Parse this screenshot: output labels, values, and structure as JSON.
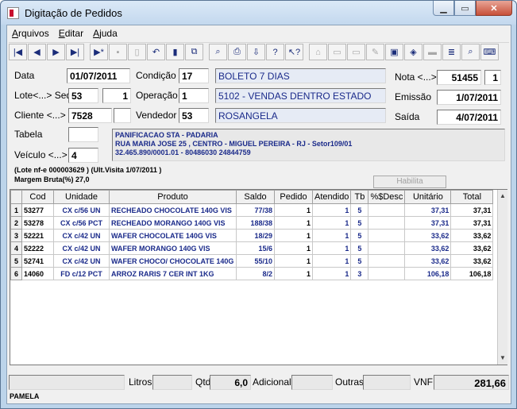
{
  "window": {
    "title": "Digitação de Pedidos"
  },
  "menu": [
    {
      "label": "Arquivos",
      "u": "A",
      "rest": "rquivos"
    },
    {
      "label": "Editar",
      "u": "E",
      "rest": "ditar"
    },
    {
      "label": "Ajuda",
      "u": "A",
      "rest": "juda"
    }
  ],
  "toolbar": {
    "icons": [
      "first-icon",
      "prev-icon",
      "next-icon",
      "last-icon",
      "new-record-icon",
      "save-icon",
      "delete-icon",
      "undo-icon",
      "books-icon",
      "copy-icon",
      "binoculars-icon",
      "print-icon",
      "import-icon",
      "help-icon",
      "context-help-icon",
      "stamp-icon",
      "doc-icon",
      "doc2-icon",
      "edit-doc-icon",
      "window-icon",
      "eraser-icon",
      "truck-icon",
      "list-icon",
      "search-doc-icon",
      "keyboard-icon"
    ],
    "glyphs": [
      "|◀",
      "◀",
      "▶",
      "▶|",
      "▶*",
      "▪",
      "▯",
      "↶",
      "▮",
      "⧉",
      "⌕",
      "⎙",
      "⇩",
      "?",
      "↖?",
      "⌂",
      "▭",
      "▭",
      "✎",
      "▣",
      "◈",
      "▬",
      "≣",
      "⌕",
      "⌨"
    ]
  },
  "form": {
    "data_label": "Data",
    "data_value": "01/07/2011",
    "condicao_label": "Condição",
    "condicao_code": "17",
    "condicao_desc": "BOLETO 7 DIAS",
    "nota_label": "Nota <...>",
    "nota_value": "51455",
    "nota_serie": "1",
    "lote_label": "Lote<...> Seq",
    "lote_value": "53",
    "seq_value": "1",
    "operacao_label": "Operação",
    "operacao_code": "1",
    "operacao_desc": "5102 - VENDAS DENTRO ESTADO",
    "emissao_label": "Emissão",
    "emissao_value": "1/07/2011",
    "cliente_label": "Cliente <...>",
    "cliente_value": "7528",
    "cliente_extra": "",
    "vendedor_label": "Vendedor",
    "vendedor_code": "53",
    "vendedor_name": "ROSANGELA",
    "saida_label": "Saída",
    "saida_value": "4/07/2011",
    "tabela_label": "Tabela",
    "tabela_value": "",
    "veiculo_label": "Veículo <...>",
    "veiculo_value": "4",
    "addr_line1": "PANIFICACAO STA - PADARIA",
    "addr_line2": "RUA MARIA JOSE 25 ,         CENTRO - MIGUEL PEREIRA - RJ - Setor109/01",
    "addr_line3": "32.465.890/0001.01   - 80486030 24844759",
    "lote_nfe": "(Lote nf-e 000003629 ) (Ult.Visita  1/07/2011 )",
    "margem": "Margem Bruta(%)  27,0",
    "habilita_label": "Habilita"
  },
  "grid": {
    "headers": [
      "",
      "Cod",
      "Unidade",
      "Produto",
      "Saldo",
      "Pedido",
      "Atendido",
      "Tb",
      "%$Desc",
      "Unitário",
      "Total"
    ],
    "rows": [
      [
        "1",
        "53277",
        "CX  c/56 UN",
        "RECHEADO CHOCOLATE 140G VIS",
        "77/38",
        "1",
        "1",
        "5",
        "",
        "37,31",
        "37,31"
      ],
      [
        "2",
        "53278",
        "CX  c/56 PCT",
        "RECHEADO MORANGO 140G VIS",
        "188/38",
        "1",
        "1",
        "5",
        "",
        "37,31",
        "37,31"
      ],
      [
        "3",
        "52221",
        "CX  c/42 UN",
        "WAFER CHOCOLATE 140G VIS",
        "18/29",
        "1",
        "1",
        "5",
        "",
        "33,62",
        "33,62"
      ],
      [
        "4",
        "52222",
        "CX  c/42 UN",
        "WAFER MORANGO 140G VIS",
        "15/6",
        "1",
        "1",
        "5",
        "",
        "33,62",
        "33,62"
      ],
      [
        "5",
        "52741",
        "CX  c/42 UN",
        "WAFER CHOCO/ CHOCOLATE 140G",
        "55/10",
        "1",
        "1",
        "5",
        "",
        "33,62",
        "33,62"
      ],
      [
        "6",
        "14060",
        "FD  c/12 PCT",
        "ARROZ RARIS 7 CER INT 1KG",
        "8/2",
        "1",
        "1",
        "3",
        "",
        "106,18",
        "106,18"
      ]
    ]
  },
  "totals": {
    "litros_label": "Litros",
    "litros_value": "",
    "qtd_label": "Qtd",
    "qtd_value": "6,0",
    "adicional_label": "Adicional",
    "adicional_value": "",
    "outras_label": "Outras",
    "outras_value": "",
    "vnf_label": "VNF",
    "vnf_value": "281,66",
    "blank_value": ""
  },
  "status": {
    "user": "PAMELA"
  }
}
